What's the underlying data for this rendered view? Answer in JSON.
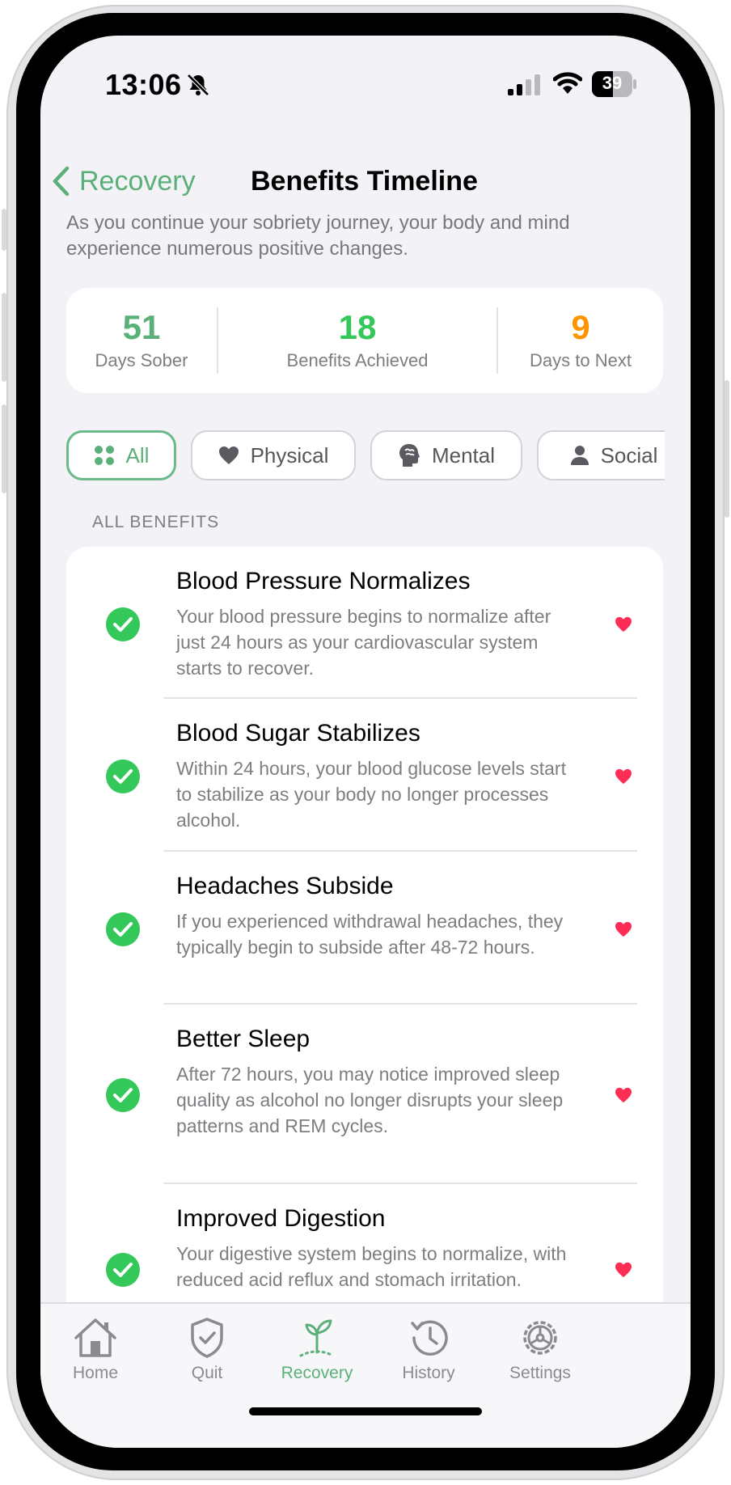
{
  "status_bar": {
    "time": "13:06",
    "battery": "39"
  },
  "nav": {
    "back_label": "Recovery",
    "title": "Benefits Timeline"
  },
  "intro": "As you continue your sobriety journey, your body and mind experience numerous positive changes.",
  "stats": [
    {
      "value": "51",
      "label": "Days Sober",
      "color": "#5bb07a"
    },
    {
      "value": "18",
      "label": "Benefits Achieved",
      "color": "#34c759"
    },
    {
      "value": "9",
      "label": "Days to Next",
      "color": "#ff9500"
    }
  ],
  "filters": [
    {
      "label": "All",
      "icon": "grid-icon",
      "active": true
    },
    {
      "label": "Physical",
      "icon": "heart-icon",
      "active": false
    },
    {
      "label": "Mental",
      "icon": "brain-icon",
      "active": false
    },
    {
      "label": "Social",
      "icon": "person-icon",
      "active": false
    }
  ],
  "section_header": "ALL BENEFITS",
  "benefits": [
    {
      "title": "Blood Pressure Normalizes",
      "description": "Your blood pressure begins to normalize after just 24 hours as your cardiovascular system starts to recover."
    },
    {
      "title": "Blood Sugar Stabilizes",
      "description": "Within 24 hours, your blood glucose levels start to stabilize as your body no longer processes alcohol."
    },
    {
      "title": "Headaches Subside",
      "description": "If you experienced withdrawal headaches, they typically begin to subside after 48-72 hours."
    },
    {
      "title": "Better Sleep",
      "description": "After 72 hours, you may notice improved sleep quality as alcohol no longer disrupts your sleep patterns and REM cycles."
    },
    {
      "title": "Improved Digestion",
      "description": "Your digestive system begins to normalize, with reduced acid reflux and stomach irritation."
    }
  ],
  "tabs": [
    {
      "label": "Home",
      "icon": "house-icon",
      "active": false
    },
    {
      "label": "Quit",
      "icon": "shield-check-icon",
      "active": false
    },
    {
      "label": "Recovery",
      "icon": "sprout-icon",
      "active": true
    },
    {
      "label": "History",
      "icon": "clock-history-icon",
      "active": false
    },
    {
      "label": "Settings",
      "icon": "gear-icon",
      "active": false
    }
  ],
  "colors": {
    "accent": "#5bb07a",
    "check": "#34c759",
    "heart": "#ff2d55"
  }
}
